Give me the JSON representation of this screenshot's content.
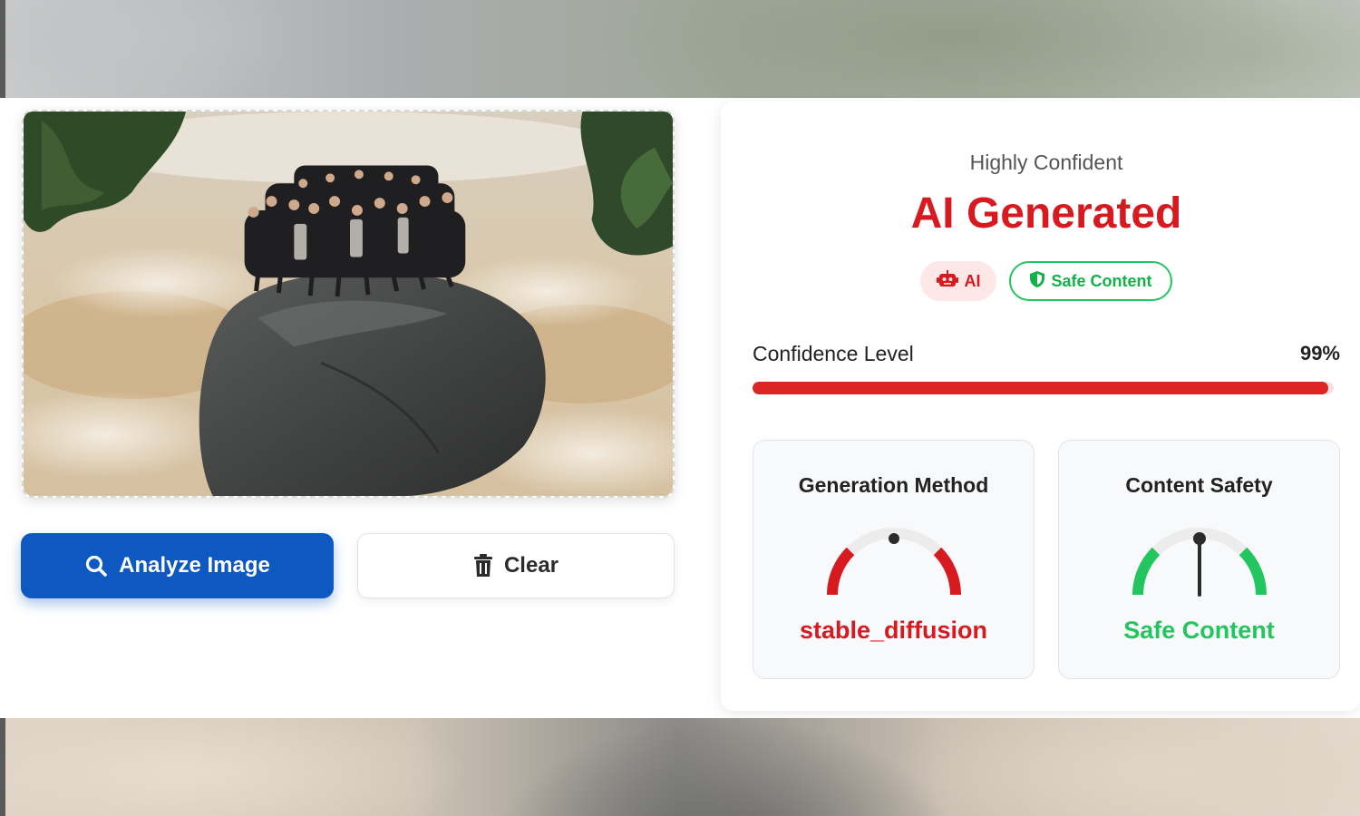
{
  "analysis": {
    "subtitle": "Highly Confident",
    "verdict": "AI Generated",
    "badges": {
      "ai_label": "AI",
      "safe_label": "Safe Content"
    },
    "confidence": {
      "label": "Confidence Level",
      "value_text": "99%",
      "value": 0.99
    },
    "cards": {
      "method": {
        "title": "Generation Method",
        "value": "stable_diffusion",
        "gauge_color": "#d71920"
      },
      "safety": {
        "title": "Content Safety",
        "value": "Safe Content",
        "gauge_color": "#22c55e"
      }
    }
  },
  "actions": {
    "analyze_label": "Analyze Image",
    "clear_label": "Clear"
  },
  "icons": {
    "analyze": "search-icon",
    "clear": "trash-icon",
    "ai_badge": "robot-icon",
    "safe_badge": "shield-icon"
  },
  "colors": {
    "primary": "#0e58c1",
    "danger": "#d71920",
    "safe": "#22c55e"
  }
}
